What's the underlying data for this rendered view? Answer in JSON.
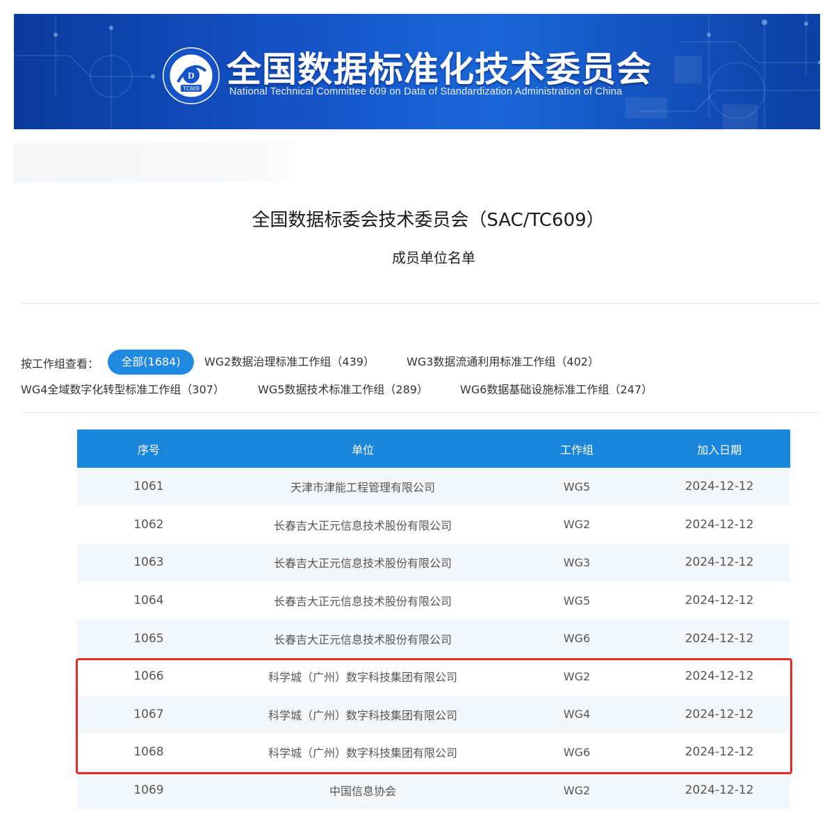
{
  "banner": {
    "title": "全国数据标准化技术委员会",
    "subtitle": "National Technical Committee 609 on Data of Standardization Administration of China",
    "logo_icon": "tc609-logo-icon",
    "logo_text": "TC609"
  },
  "heading": {
    "title": "全国数据标委会技术委员会（SAC/TC609）",
    "subtitle": "成员单位名单"
  },
  "filter": {
    "label": "按工作组查看：",
    "items": [
      {
        "label": "全部(1684)",
        "active": true
      },
      {
        "label": "WG2数据治理标准工作组（439）",
        "active": false
      },
      {
        "label": "WG3数据流通利用标准工作组（402）",
        "active": false
      },
      {
        "label": "WG4全域数字化转型标准工作组（307）",
        "active": false
      },
      {
        "label": "WG5数据技术标准工作组（289）",
        "active": false
      },
      {
        "label": "WG6数据基础设施标准工作组（247）",
        "active": false
      }
    ]
  },
  "table": {
    "headers": [
      "序号",
      "单位",
      "工作组",
      "加入日期"
    ],
    "rows": [
      {
        "no": "1061",
        "unit": "天津市津能工程管理有限公司",
        "group": "WG5",
        "date": "2024-12-12"
      },
      {
        "no": "1062",
        "unit": "长春吉大正元信息技术股份有限公司",
        "group": "WG2",
        "date": "2024-12-12"
      },
      {
        "no": "1063",
        "unit": "长春吉大正元信息技术股份有限公司",
        "group": "WG3",
        "date": "2024-12-12"
      },
      {
        "no": "1064",
        "unit": "长春吉大正元信息技术股份有限公司",
        "group": "WG5",
        "date": "2024-12-12"
      },
      {
        "no": "1065",
        "unit": "长春吉大正元信息技术股份有限公司",
        "group": "WG6",
        "date": "2024-12-12"
      },
      {
        "no": "1066",
        "unit": "科学城（广州）数字科技集团有限公司",
        "group": "WG2",
        "date": "2024-12-12"
      },
      {
        "no": "1067",
        "unit": "科学城（广州）数字科技集团有限公司",
        "group": "WG4",
        "date": "2024-12-12"
      },
      {
        "no": "1068",
        "unit": "科学城（广州）数字科技集团有限公司",
        "group": "WG6",
        "date": "2024-12-12"
      },
      {
        "no": "1069",
        "unit": "中国信息协会",
        "group": "WG2",
        "date": "2024-12-12"
      }
    ]
  },
  "colors": {
    "accent": "#1a86db",
    "chip_active": "#1f88e0",
    "row_stripe": "#f2f7fc",
    "highlight": "#e52a2a",
    "banner_blue": "#1553c7"
  }
}
